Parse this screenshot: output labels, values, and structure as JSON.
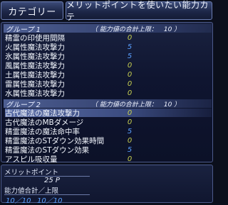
{
  "header": {
    "category_label": "カテゴリー",
    "title": "メリットポイントを使いたい能力カテ"
  },
  "groups": [
    {
      "name": "グループ 1",
      "limit": "（ 能力値の合計上限：　10 ）",
      "items": [
        {
          "label": "精霊の印使用間隔",
          "value": "0",
          "color": "#c8d050"
        },
        {
          "label": "火属性魔法攻撃力",
          "value": "5",
          "color": "#5aa0ff"
        },
        {
          "label": "氷属性魔法攻撃力",
          "value": "5",
          "color": "#5aa0ff"
        },
        {
          "label": "風属性魔法攻撃力",
          "value": "0",
          "color": "#c8d050"
        },
        {
          "label": "土属性魔法攻撃力",
          "value": "0",
          "color": "#c8d050"
        },
        {
          "label": "雷属性魔法攻撃力",
          "value": "0",
          "color": "#c8d050"
        },
        {
          "label": "水属性魔法攻撃力",
          "value": "0",
          "color": "#c8d050"
        }
      ]
    },
    {
      "name": "グループ 2",
      "limit": "（ 能力値の合計上限：　10 ）",
      "items": [
        {
          "label": "古代魔法の魔法攻撃力",
          "value": "0",
          "color": "#c8d050"
        },
        {
          "label": "古代魔法のMBダメージ",
          "value": "0",
          "color": "#c8d050"
        },
        {
          "label": "精霊魔法の魔法命中率",
          "value": "5",
          "color": "#5aa0ff"
        },
        {
          "label": "精霊魔法のSTダウン効果時間",
          "value": "0",
          "color": "#c8d050"
        },
        {
          "label": "精霊魔法のSTダウン効果",
          "value": "5",
          "color": "#5aa0ff"
        },
        {
          "label": "アスピル吸収量",
          "value": "0",
          "color": "#c8d050"
        }
      ]
    }
  ],
  "footer": {
    "merit_points_label": "メリットポイント",
    "merit_points_value": "25 P",
    "cap_label": "能力値合計／上限",
    "cap_group1": "10／10",
    "cap_group2": "10／10",
    "cap_color": "#5aa0ff"
  }
}
